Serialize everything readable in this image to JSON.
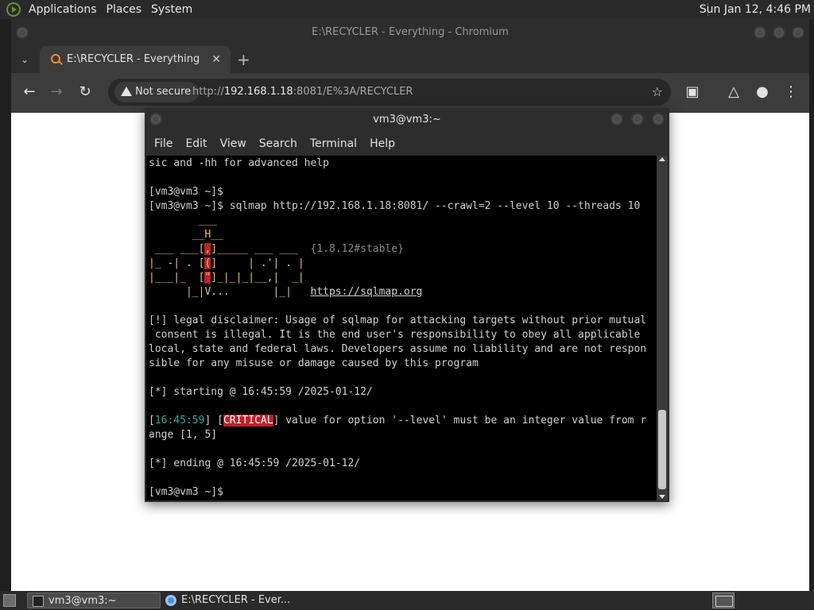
{
  "top_panel": {
    "menus": [
      "Applications",
      "Places",
      "System"
    ],
    "clock": "Sun Jan 12,  4:46 PM"
  },
  "browser": {
    "window_title": "E:\\RECYCLER - Everything - Chromium",
    "tab_title": "E:\\RECYCLER - Everything",
    "tab_close": "✕",
    "new_tab": "+",
    "security_label": "Not secure",
    "url_scheme": "http://",
    "url_host": "192.168.1.18",
    "url_rest": ":8081/E%3A/RECYCLER"
  },
  "terminal": {
    "title": "vm3@vm3:~",
    "menus": [
      "File",
      "Edit",
      "View",
      "Search",
      "Terminal",
      "Help"
    ],
    "lines": {
      "l1": "sic and -hh for advanced help",
      "l2": "[vm3@vm3 ~]$",
      "l3": "[vm3@vm3 ~]$ sqlmap http://192.168.1.18:8081/ --crawl=2 --level 10 --threads 10",
      "version": "1.8.12#stable",
      "site": "https://sqlmap.org",
      "d1": "[!] legal disclaimer: Usage of sqlmap for attacking targets without prior mutual",
      "d2": " consent is illegal. It is the end user's responsibility to obey all applicable",
      "d3": "local, state and federal laws. Developers assume no liability and are not respon",
      "d4": "sible for any misuse or damage caused by this program",
      "start": "[*] starting @ 16:45:59 /2025-01-12/",
      "crit_time": "16:45:59",
      "crit_tag": "CRITICAL",
      "crit_msg": "] value for option '--level' must be an integer value from r",
      "crit2": "ange [1, 5]",
      "end": "[*] ending @ 16:45:59 /2025-01-12/",
      "prompt": "[vm3@vm3 ~]$"
    }
  },
  "taskbar": {
    "task1": "vm3@vm3:~",
    "task2": "E:\\RECYCLER - Ever..."
  }
}
